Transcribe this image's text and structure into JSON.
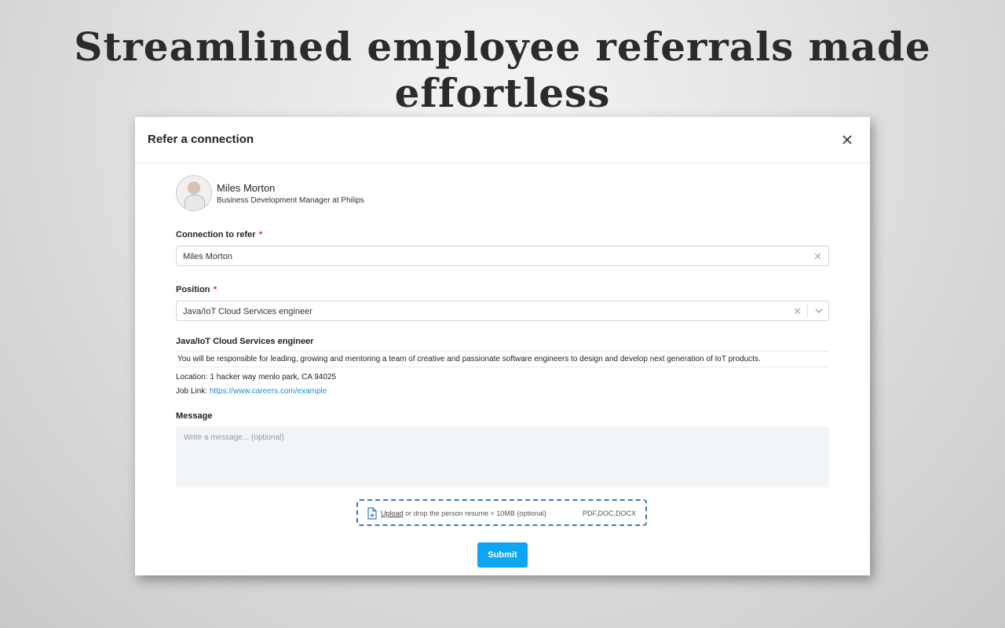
{
  "headline": "Streamlined employee referrals made effortless",
  "modal": {
    "title": "Refer a connection",
    "close_icon": "close-icon"
  },
  "profile": {
    "name": "Miles Morton",
    "role": "Business Development Manager at Philips"
  },
  "connection": {
    "label": "Connection to refer",
    "required_mark": "*",
    "value": "Miles Morton",
    "clear_glyph": "✕"
  },
  "position": {
    "label": "Position",
    "required_mark": "*",
    "value": "Java/IoT Cloud Services engineer",
    "clear_glyph": "✕"
  },
  "job": {
    "title": "Java/IoT Cloud Services engineer",
    "description": "You will be responsible for leading, growing and mentoring a team of creative and passionate software engineers to design and develop next generation of IoT products.",
    "location_label": "Location:",
    "location": "1 hacker way menlo park, CA 94025",
    "link_label": "Job Link:",
    "link": "https://www.careers.com/example"
  },
  "message": {
    "label": "Message",
    "placeholder": "Write a message... (optional)"
  },
  "upload": {
    "link_text": "Upload",
    "text": "or drop the person resume < 10MB (optional)",
    "types": "PDF,DOC,DOCX"
  },
  "submit_label": "Submit",
  "colors": {
    "accent": "#0ea5f2",
    "required": "#e0245e",
    "link": "#1a8fd8",
    "upload_border": "#3a78c3"
  }
}
